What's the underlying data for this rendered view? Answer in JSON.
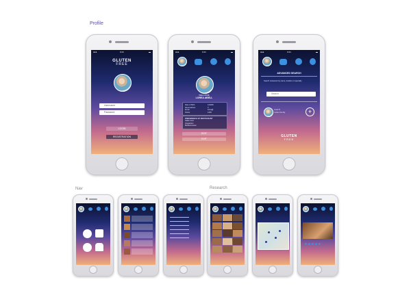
{
  "labels": {
    "profile": "Profile",
    "nav": "Nav",
    "research": "Research"
  },
  "status": {
    "time": "9:41",
    "signal": "●●●",
    "battery": "▬"
  },
  "login": {
    "logo_top": "GLUTEN",
    "logo_bottom": "FREE",
    "username_placeholder": "Username",
    "password_placeholder": "Password",
    "login_button": "LOGIN",
    "register_button": "REGISTRATION"
  },
  "profile": {
    "greeting": "WELCOME",
    "name": "LOREA ABELL",
    "info_rows": [
      "Date of Birth",
      "Reservations",
      "Email",
      "Points"
    ],
    "info_values": [
      "12/3/95",
      "3",
      "lorea@",
      "1200"
    ],
    "section_title": "PREFERENCE OF RESTAURANT",
    "preferences": [
      "Italian food",
      "Vegetarian",
      "Mediterranean"
    ],
    "btn_edit": "EDIT",
    "btn_logout": "EXIT"
  },
  "search": {
    "title": "ADVANCED SEARCH",
    "note": "Search restaurant by name, location or specialty",
    "input_placeholder": "Search",
    "result_name": "Josef B.",
    "result_sub": "Celiac friendly",
    "add_icon": "plus-icon",
    "logo_top": "GLUTEN",
    "logo_bottom": "FREE"
  },
  "colors": {
    "accent": "#3d8fe0",
    "label": "#5a4fa8"
  }
}
